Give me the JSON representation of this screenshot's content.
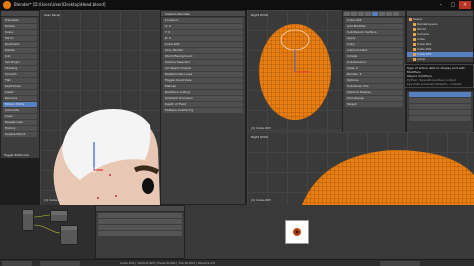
{
  "window": {
    "title": "Blender* [D:\\Users\\User\\Desktop\\Head.blend]",
    "controls": [
      "–",
      "□",
      "×"
    ]
  },
  "toolshelf": {
    "items": [
      "Translate",
      "Rotate",
      "Scale",
      "Mirror",
      "Duplicate",
      "Delete",
      "Join",
      "Set Origin",
      "Shading",
      "Smooth",
      "Flat",
      "Keyframes",
      "Insert",
      "Remove",
      "Motion Paths",
      "Calculate",
      "Clear",
      "Repeat Last",
      "History",
      "Grease Pencil"
    ],
    "bottom_label": "Toggle Editmode"
  },
  "viewport_main": {
    "header_label": "User Persp",
    "object_label": "(1) Cube.003"
  },
  "properties_mid": {
    "title": "Custom Normals",
    "sections": [
      "3D Cursor",
      "Item",
      "Display",
      "Shading",
      "Motion Tracking",
      "Background Images"
    ],
    "rows": [
      "Location:",
      "X: 0",
      "Y: 0",
      "Z: 0",
      "Cube.003",
      "Only Render",
      "World Background",
      "Outline Selected",
      "All Object Origins",
      "Relationship Lines",
      "Toggle Quad View",
      "Matcap",
      "Backface Culling",
      "Ambient Occlusion",
      "Depth of Field",
      "Multiple Scattering"
    ]
  },
  "viewport_top": {
    "header_label": "Right Ortho",
    "object_label": "(1) Cube.003"
  },
  "viewport_bottom": {
    "header_label": "Right Ortho",
    "object_label": "(1) Cube.003"
  },
  "properties_right": {
    "tabs": [
      "Scene",
      "Render Layers",
      "World",
      "Object",
      "Modifiers",
      "Data",
      "Material",
      "Texture"
    ],
    "rows": [
      "Cube.003",
      "Add Modifier",
      "Subdivision Surface",
      "Apply",
      "Copy",
      "Catmull-Clark",
      "Simple",
      "Subdivisions:",
      "View: 2",
      "Render: 2",
      "Options",
      "Subdivide UVs",
      "Optimal Display",
      "Shrinkwrap",
      "Target:"
    ]
  },
  "outliner": {
    "items": [
      "Scene",
      "RenderLayers",
      "World",
      "Camera",
      "Cube",
      "Cube.001",
      "Cube.002",
      "Cube.003",
      "Lamp"
    ]
  },
  "tooltip": {
    "line1": "Type of active data to display and edit: Modifiers",
    "line2": "Object modifiers",
    "line3": "Python: SpaceProperties.context",
    "line4": "bpy.data.screens['Default']...context"
  },
  "node_editor": {
    "labels": [
      "Image Texture",
      "Material Output",
      "Diffuse BSDF"
    ]
  },
  "image_preview": {
    "label": "Render Result"
  },
  "status": {
    "left": "Cube.003 | Verts:8,420 | Faces:8,400 | Tris:16,800 | Objects:1/5"
  }
}
